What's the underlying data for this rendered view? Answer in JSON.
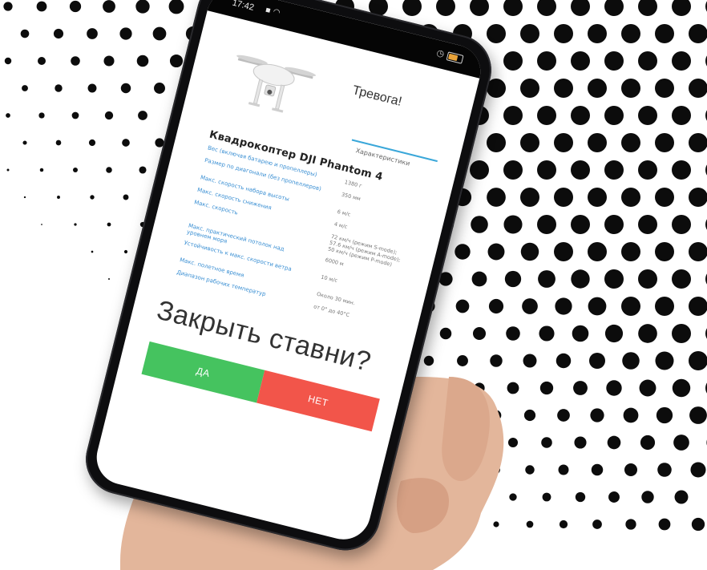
{
  "colors": {
    "dots": "#0c0c0c",
    "yes_button": "#45c35f",
    "no_button": "#f2554a",
    "spec_name": "#3a8fd3",
    "tab_underline": "#3aa7d9"
  },
  "statusbar": {
    "time": "17:42",
    "icons": "▪ ◠",
    "battery_level": 0.7
  },
  "screen": {
    "alarm_title": "Тревога!",
    "characteristics_tab": "Характеристики",
    "product_title": "Квадрокоптер DJI Phantom 4",
    "specs": [
      {
        "name": "Вес (включая батарею и пропеллеры)",
        "value": "1380 г"
      },
      {
        "name": "Размер по диагонали (без пропеллеров)",
        "value": "350 мм"
      },
      {
        "name": "Макс. скорость набора высоты",
        "value": "6 м/с"
      },
      {
        "name": "Макс. скорость снижения",
        "value": "4 м/с"
      },
      {
        "name": "Макс. скорость",
        "value": "72 км/ч (режим S-mode); 57.6 км/ч (режим A-mode); 50 км/ч (режим P-mode)"
      },
      {
        "name": "Макс. практический потолок над уровнем моря",
        "value": "6000 м"
      },
      {
        "name": "Устойчивость к макс. скорости ветра",
        "value": "10 м/с"
      },
      {
        "name": "Макс. полетное время",
        "value": "Около 30 мин."
      },
      {
        "name": "Диапазон рабочих температур",
        "value": "от 0° до 40°С"
      }
    ],
    "question": "Закрыть ставни?",
    "yes_label": "ДА",
    "no_label": "НЕТ"
  }
}
